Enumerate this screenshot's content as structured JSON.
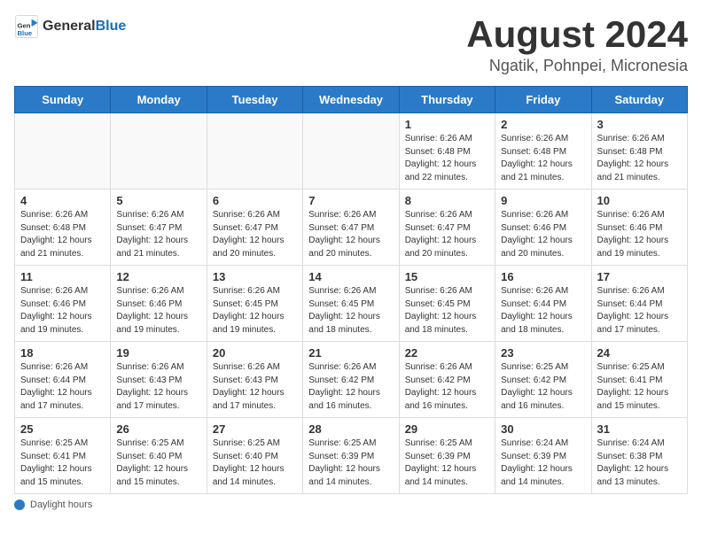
{
  "header": {
    "logo_general": "General",
    "logo_blue": "Blue",
    "title": "August 2024",
    "subtitle": "Ngatik, Pohnpei, Micronesia"
  },
  "calendar": {
    "weekdays": [
      "Sunday",
      "Monday",
      "Tuesday",
      "Wednesday",
      "Thursday",
      "Friday",
      "Saturday"
    ],
    "weeks": [
      [
        {
          "day": "",
          "info": ""
        },
        {
          "day": "",
          "info": ""
        },
        {
          "day": "",
          "info": ""
        },
        {
          "day": "",
          "info": ""
        },
        {
          "day": "1",
          "info": "Sunrise: 6:26 AM\nSunset: 6:48 PM\nDaylight: 12 hours\nand 22 minutes."
        },
        {
          "day": "2",
          "info": "Sunrise: 6:26 AM\nSunset: 6:48 PM\nDaylight: 12 hours\nand 21 minutes."
        },
        {
          "day": "3",
          "info": "Sunrise: 6:26 AM\nSunset: 6:48 PM\nDaylight: 12 hours\nand 21 minutes."
        }
      ],
      [
        {
          "day": "4",
          "info": "Sunrise: 6:26 AM\nSunset: 6:48 PM\nDaylight: 12 hours\nand 21 minutes."
        },
        {
          "day": "5",
          "info": "Sunrise: 6:26 AM\nSunset: 6:47 PM\nDaylight: 12 hours\nand 21 minutes."
        },
        {
          "day": "6",
          "info": "Sunrise: 6:26 AM\nSunset: 6:47 PM\nDaylight: 12 hours\nand 20 minutes."
        },
        {
          "day": "7",
          "info": "Sunrise: 6:26 AM\nSunset: 6:47 PM\nDaylight: 12 hours\nand 20 minutes."
        },
        {
          "day": "8",
          "info": "Sunrise: 6:26 AM\nSunset: 6:47 PM\nDaylight: 12 hours\nand 20 minutes."
        },
        {
          "day": "9",
          "info": "Sunrise: 6:26 AM\nSunset: 6:46 PM\nDaylight: 12 hours\nand 20 minutes."
        },
        {
          "day": "10",
          "info": "Sunrise: 6:26 AM\nSunset: 6:46 PM\nDaylight: 12 hours\nand 19 minutes."
        }
      ],
      [
        {
          "day": "11",
          "info": "Sunrise: 6:26 AM\nSunset: 6:46 PM\nDaylight: 12 hours\nand 19 minutes."
        },
        {
          "day": "12",
          "info": "Sunrise: 6:26 AM\nSunset: 6:46 PM\nDaylight: 12 hours\nand 19 minutes."
        },
        {
          "day": "13",
          "info": "Sunrise: 6:26 AM\nSunset: 6:45 PM\nDaylight: 12 hours\nand 19 minutes."
        },
        {
          "day": "14",
          "info": "Sunrise: 6:26 AM\nSunset: 6:45 PM\nDaylight: 12 hours\nand 18 minutes."
        },
        {
          "day": "15",
          "info": "Sunrise: 6:26 AM\nSunset: 6:45 PM\nDaylight: 12 hours\nand 18 minutes."
        },
        {
          "day": "16",
          "info": "Sunrise: 6:26 AM\nSunset: 6:44 PM\nDaylight: 12 hours\nand 18 minutes."
        },
        {
          "day": "17",
          "info": "Sunrise: 6:26 AM\nSunset: 6:44 PM\nDaylight: 12 hours\nand 17 minutes."
        }
      ],
      [
        {
          "day": "18",
          "info": "Sunrise: 6:26 AM\nSunset: 6:44 PM\nDaylight: 12 hours\nand 17 minutes."
        },
        {
          "day": "19",
          "info": "Sunrise: 6:26 AM\nSunset: 6:43 PM\nDaylight: 12 hours\nand 17 minutes."
        },
        {
          "day": "20",
          "info": "Sunrise: 6:26 AM\nSunset: 6:43 PM\nDaylight: 12 hours\nand 17 minutes."
        },
        {
          "day": "21",
          "info": "Sunrise: 6:26 AM\nSunset: 6:42 PM\nDaylight: 12 hours\nand 16 minutes."
        },
        {
          "day": "22",
          "info": "Sunrise: 6:26 AM\nSunset: 6:42 PM\nDaylight: 12 hours\nand 16 minutes."
        },
        {
          "day": "23",
          "info": "Sunrise: 6:25 AM\nSunset: 6:42 PM\nDaylight: 12 hours\nand 16 minutes."
        },
        {
          "day": "24",
          "info": "Sunrise: 6:25 AM\nSunset: 6:41 PM\nDaylight: 12 hours\nand 15 minutes."
        }
      ],
      [
        {
          "day": "25",
          "info": "Sunrise: 6:25 AM\nSunset: 6:41 PM\nDaylight: 12 hours\nand 15 minutes."
        },
        {
          "day": "26",
          "info": "Sunrise: 6:25 AM\nSunset: 6:40 PM\nDaylight: 12 hours\nand 15 minutes."
        },
        {
          "day": "27",
          "info": "Sunrise: 6:25 AM\nSunset: 6:40 PM\nDaylight: 12 hours\nand 14 minutes."
        },
        {
          "day": "28",
          "info": "Sunrise: 6:25 AM\nSunset: 6:39 PM\nDaylight: 12 hours\nand 14 minutes."
        },
        {
          "day": "29",
          "info": "Sunrise: 6:25 AM\nSunset: 6:39 PM\nDaylight: 12 hours\nand 14 minutes."
        },
        {
          "day": "30",
          "info": "Sunrise: 6:24 AM\nSunset: 6:39 PM\nDaylight: 12 hours\nand 14 minutes."
        },
        {
          "day": "31",
          "info": "Sunrise: 6:24 AM\nSunset: 6:38 PM\nDaylight: 12 hours\nand 13 minutes."
        }
      ]
    ]
  },
  "footer": {
    "daylight_label": "Daylight hours"
  }
}
